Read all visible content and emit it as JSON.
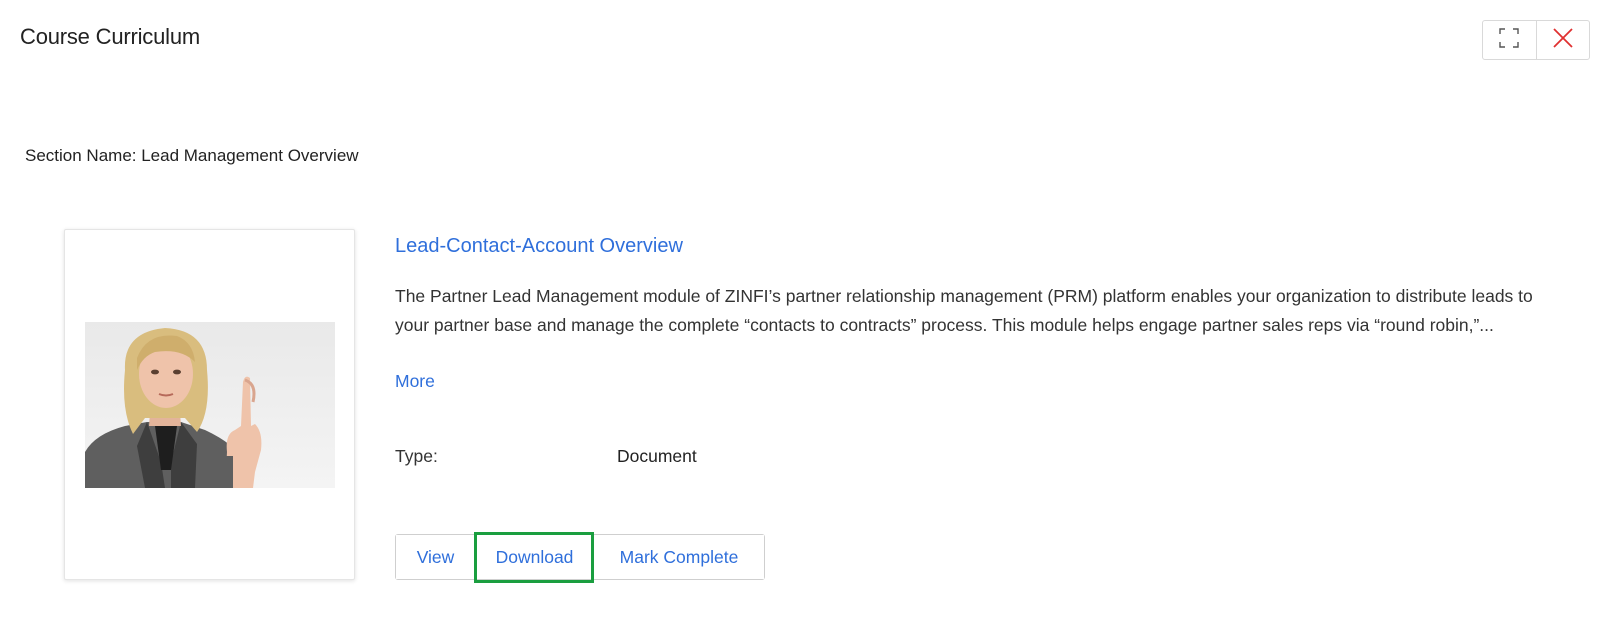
{
  "modal": {
    "title": "Course Curriculum",
    "controls": [
      "fullscreen-icon",
      "close-icon"
    ],
    "close_color": "#e03030"
  },
  "section": {
    "name": "Section Name: Lead Management Overview"
  },
  "item": {
    "title": "Lead-Contact-Account Overview",
    "description": "The Partner Lead Management module of ZINFI’s partner relationship management (PRM) platform enables your organization to distribute leads to your partner base and manage the complete “contacts to contracts” process. This module helps engage partner sales reps via “round robin,”...",
    "more_label": "More",
    "type_label": "Type:",
    "type_value": "Document",
    "thumbnail": "woman-crossed-fingers-photo"
  },
  "actions": {
    "view": "View",
    "download": "Download",
    "mark_complete": "Mark Complete"
  },
  "colors": {
    "link": "#2f6fdb",
    "highlight": "#1a9e3f"
  }
}
